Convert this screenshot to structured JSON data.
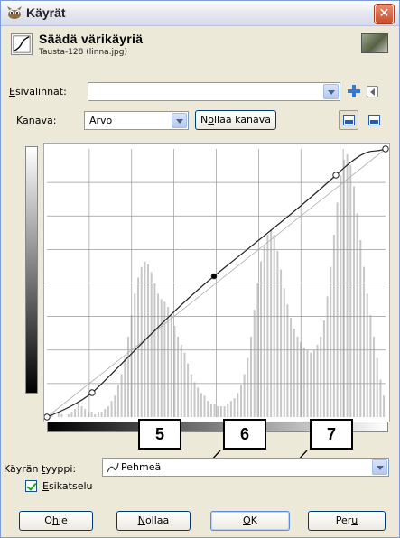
{
  "window": {
    "title": "Käyrät",
    "close_glyph": "✕"
  },
  "header": {
    "title": "Säädä värikäyriä",
    "subtitle": "Tausta-128 (linna.jpg)"
  },
  "presets": {
    "label_u": "E",
    "label_rest": "sivalinnat:",
    "value": ""
  },
  "channel": {
    "label_pre": "Ka",
    "label_u": "n",
    "label_rest": "ava:",
    "value": "Arvo"
  },
  "reset_channel": {
    "pre": "N",
    "u": "o",
    "rest": "llaa kanava"
  },
  "curve_type": {
    "label_pre": "Käyrän ",
    "label_u": "t",
    "label_rest": "yyppi:",
    "value": "Pehmeä"
  },
  "preview": {
    "label_u": "E",
    "label_rest": "sikatselu",
    "checked": true
  },
  "callouts": [
    "5",
    "6",
    "7"
  ],
  "buttons": {
    "help": {
      "pre": "O",
      "u": "h",
      "rest": "je"
    },
    "reset": {
      "pre": "",
      "u": "N",
      "rest": "ollaa"
    },
    "ok": {
      "pre": "",
      "u": "O",
      "rest": "K"
    },
    "cancel": {
      "pre": "Per",
      "u": "u",
      "rest": ""
    }
  },
  "histogram": [
    0,
    1,
    0,
    2,
    1,
    0,
    1,
    2,
    3,
    5,
    4,
    3,
    2,
    2,
    1,
    2,
    2,
    3,
    4,
    6,
    8,
    12,
    16,
    22,
    30,
    38,
    46,
    52,
    56,
    58,
    57,
    54,
    50,
    46,
    44,
    43,
    41,
    38,
    34,
    30,
    27,
    24,
    20,
    16,
    13,
    11,
    9,
    8,
    6,
    5,
    5,
    4,
    4,
    4,
    5,
    6,
    7,
    9,
    12,
    16,
    22,
    30,
    40,
    50,
    58,
    64,
    68,
    70,
    68,
    62,
    55,
    48,
    42,
    37,
    33,
    30,
    28,
    26,
    25,
    24,
    25,
    27,
    30,
    36,
    45,
    56,
    68,
    80,
    90,
    96,
    98,
    94,
    86,
    76,
    66,
    56,
    46,
    38,
    30,
    22,
    14,
    8
  ]
}
